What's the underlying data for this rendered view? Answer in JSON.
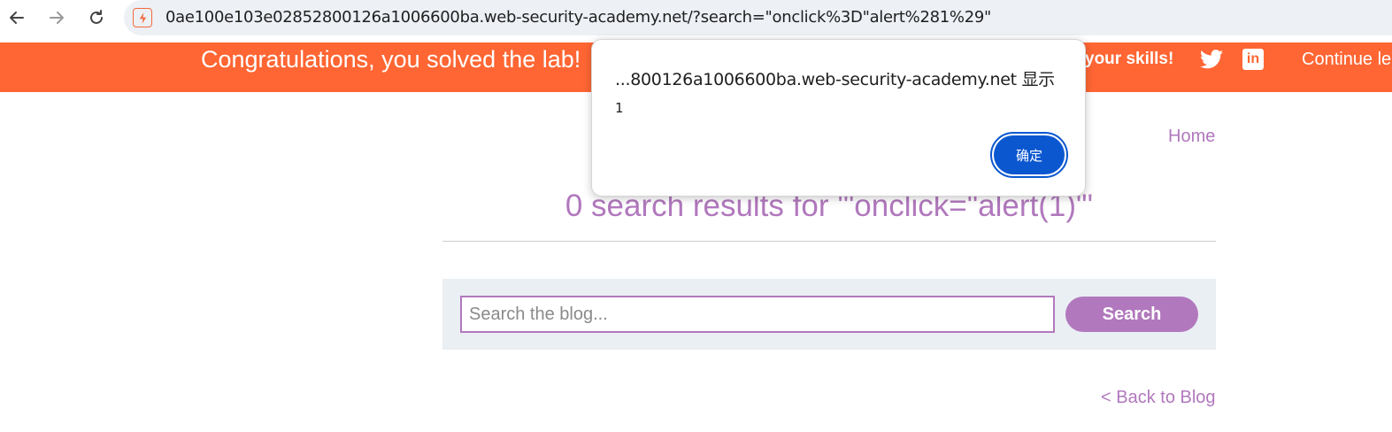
{
  "browser": {
    "url": "0ae100e103e02852800126a1006600ba.web-security-academy.net/?search=\"onclick%3D\"alert%281%29\"",
    "site_icon": "lightning-icon"
  },
  "banner": {
    "message": "Congratulations, you solved the lab!",
    "share_text": "your skills!",
    "twitter_icon": "twitter-icon",
    "linkedin_label": "in",
    "continue_label": "Continue le",
    "color": "#ff6633"
  },
  "page": {
    "home_link": "Home",
    "results_title": "0 search results for '\"onclick=\"alert(1)\"'",
    "search_placeholder": "Search the blog...",
    "search_button": "Search",
    "back_link": "< Back to Blog",
    "accent_color": "#b178bd"
  },
  "dialog": {
    "title": "...800126a1006600ba.web-security-academy.net 显示",
    "message": "1",
    "ok_button": "确定"
  }
}
